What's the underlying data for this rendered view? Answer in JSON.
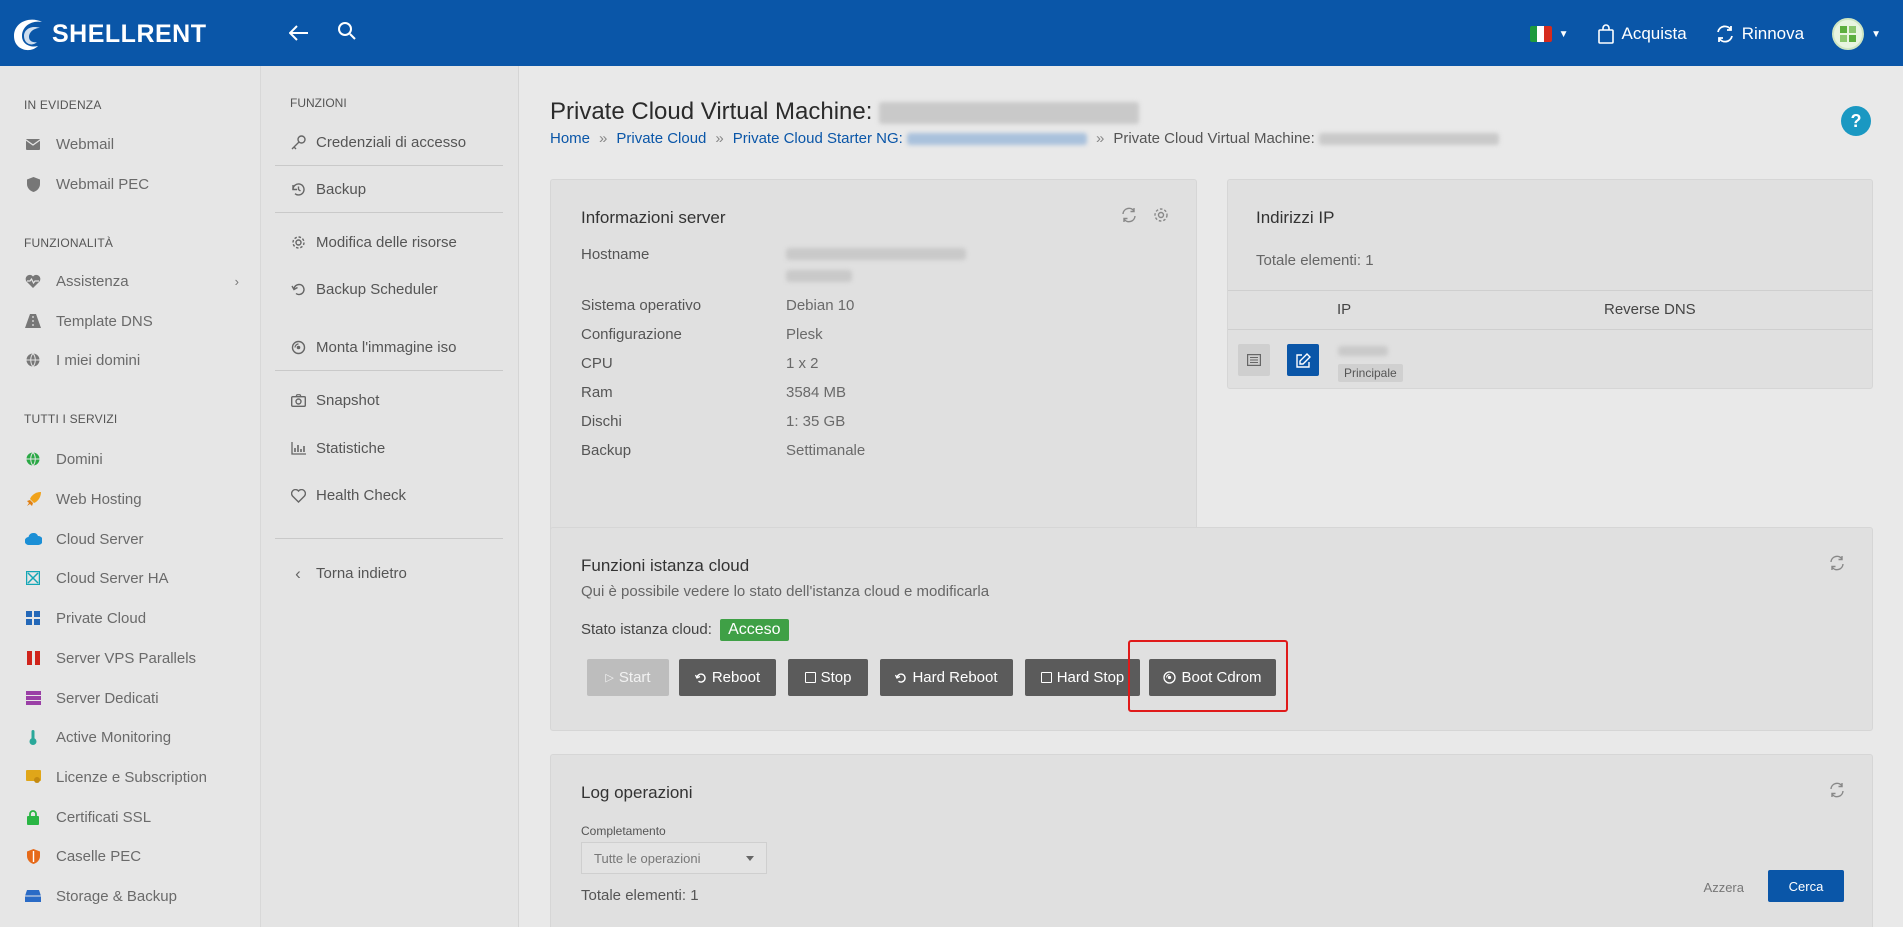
{
  "header": {
    "brand": "SHELLRENT",
    "acquista": "Acquista",
    "rinnova": "Rinnova"
  },
  "sidebar": {
    "section_evidenza": "IN EVIDENZA",
    "section_funzionalita": "FUNZIONALITÀ",
    "section_servizi": "TUTTI I SERVIZI",
    "evidenza": [
      {
        "label": "Webmail",
        "icon": "mail-icon"
      },
      {
        "label": "Webmail PEC",
        "icon": "shield-icon"
      }
    ],
    "funzionalita": [
      {
        "label": "Assistenza",
        "icon": "heartbeat-icon"
      },
      {
        "label": "Template DNS",
        "icon": "road-icon"
      },
      {
        "label": "I miei domini",
        "icon": "globe-icon"
      }
    ],
    "servizi": [
      {
        "label": "Domini",
        "icon": "globe-icon",
        "color": "#2aa845"
      },
      {
        "label": "Web Hosting",
        "icon": "rocket-icon",
        "color": "#f0a21a"
      },
      {
        "label": "Cloud Server",
        "icon": "cloud-icon",
        "color": "#1b8fd6"
      },
      {
        "label": "Cloud Server HA",
        "icon": "network-icon",
        "color": "#14a6b5"
      },
      {
        "label": "Private Cloud",
        "icon": "grid-icon",
        "color": "#2468b8"
      },
      {
        "label": "Server VPS Parallels",
        "icon": "parallels-icon",
        "color": "#d0241c"
      },
      {
        "label": "Server Dedicati",
        "icon": "server-icon",
        "color": "#9a3fa6"
      },
      {
        "label": "Active Monitoring",
        "icon": "thermometer-icon",
        "color": "#2aa89a"
      },
      {
        "label": "Licenze e Subscription",
        "icon": "certificate-icon",
        "color": "#e0a619"
      },
      {
        "label": "Certificati SSL",
        "icon": "lock-icon",
        "color": "#2ab544"
      },
      {
        "label": "Caselle PEC",
        "icon": "shield-icon",
        "color": "#e66a1a"
      },
      {
        "label": "Storage & Backup",
        "icon": "storage-icon",
        "color": "#2a6bc6"
      }
    ]
  },
  "funzioni": {
    "title": "FUNZIONI",
    "items": [
      {
        "label": "Credenziali di accesso",
        "icon": "key-icon"
      },
      {
        "label": "Backup",
        "icon": "history-icon"
      },
      {
        "label": "Modifica delle risorse",
        "icon": "gear-icon"
      },
      {
        "label": "Backup Scheduler",
        "icon": "undo-icon"
      },
      {
        "label": "Monta l'immagine iso",
        "icon": "disc-icon"
      },
      {
        "label": "Snapshot",
        "icon": "camera-icon"
      },
      {
        "label": "Statistiche",
        "icon": "chart-icon"
      },
      {
        "label": "Health Check",
        "icon": "heart-icon"
      }
    ],
    "back": "Torna indietro"
  },
  "page": {
    "title": "Private Cloud Virtual Machine:",
    "breadcrumb": [
      "Home",
      "Private Cloud",
      "Private Cloud Starter NG:",
      "Private Cloud Virtual Machine:"
    ]
  },
  "server_info": {
    "title": "Informazioni server",
    "rows": [
      {
        "label": "Hostname",
        "value": ""
      },
      {
        "label": "Sistema operativo",
        "value": "Debian 10"
      },
      {
        "label": "Configurazione",
        "value": "Plesk"
      },
      {
        "label": "CPU",
        "value": "1 x 2"
      },
      {
        "label": "Ram",
        "value": "3584 MB"
      },
      {
        "label": "Dischi",
        "value": "1: 35 GB"
      },
      {
        "label": "Backup",
        "value": "Settimanale"
      }
    ]
  },
  "ip": {
    "title": "Indirizzi IP",
    "total": "Totale elementi: 1",
    "col_ip": "IP",
    "col_dns": "Reverse DNS",
    "badge": "Principale"
  },
  "cloud_functions": {
    "title": "Funzioni istanza cloud",
    "subtitle": "Qui è possibile vedere lo stato dell'istanza cloud e modificarla",
    "status_label": "Stato istanza cloud:",
    "status_value": "Acceso",
    "buttons": [
      "Start",
      "Reboot",
      "Stop",
      "Hard Reboot",
      "Hard Stop",
      "Boot Cdrom"
    ]
  },
  "log": {
    "title": "Log operazioni",
    "filter_label": "Completamento",
    "filter_value": "Tutte le operazioni",
    "total": "Totale elementi: 1",
    "reset": "Azzera",
    "search": "Cerca"
  }
}
